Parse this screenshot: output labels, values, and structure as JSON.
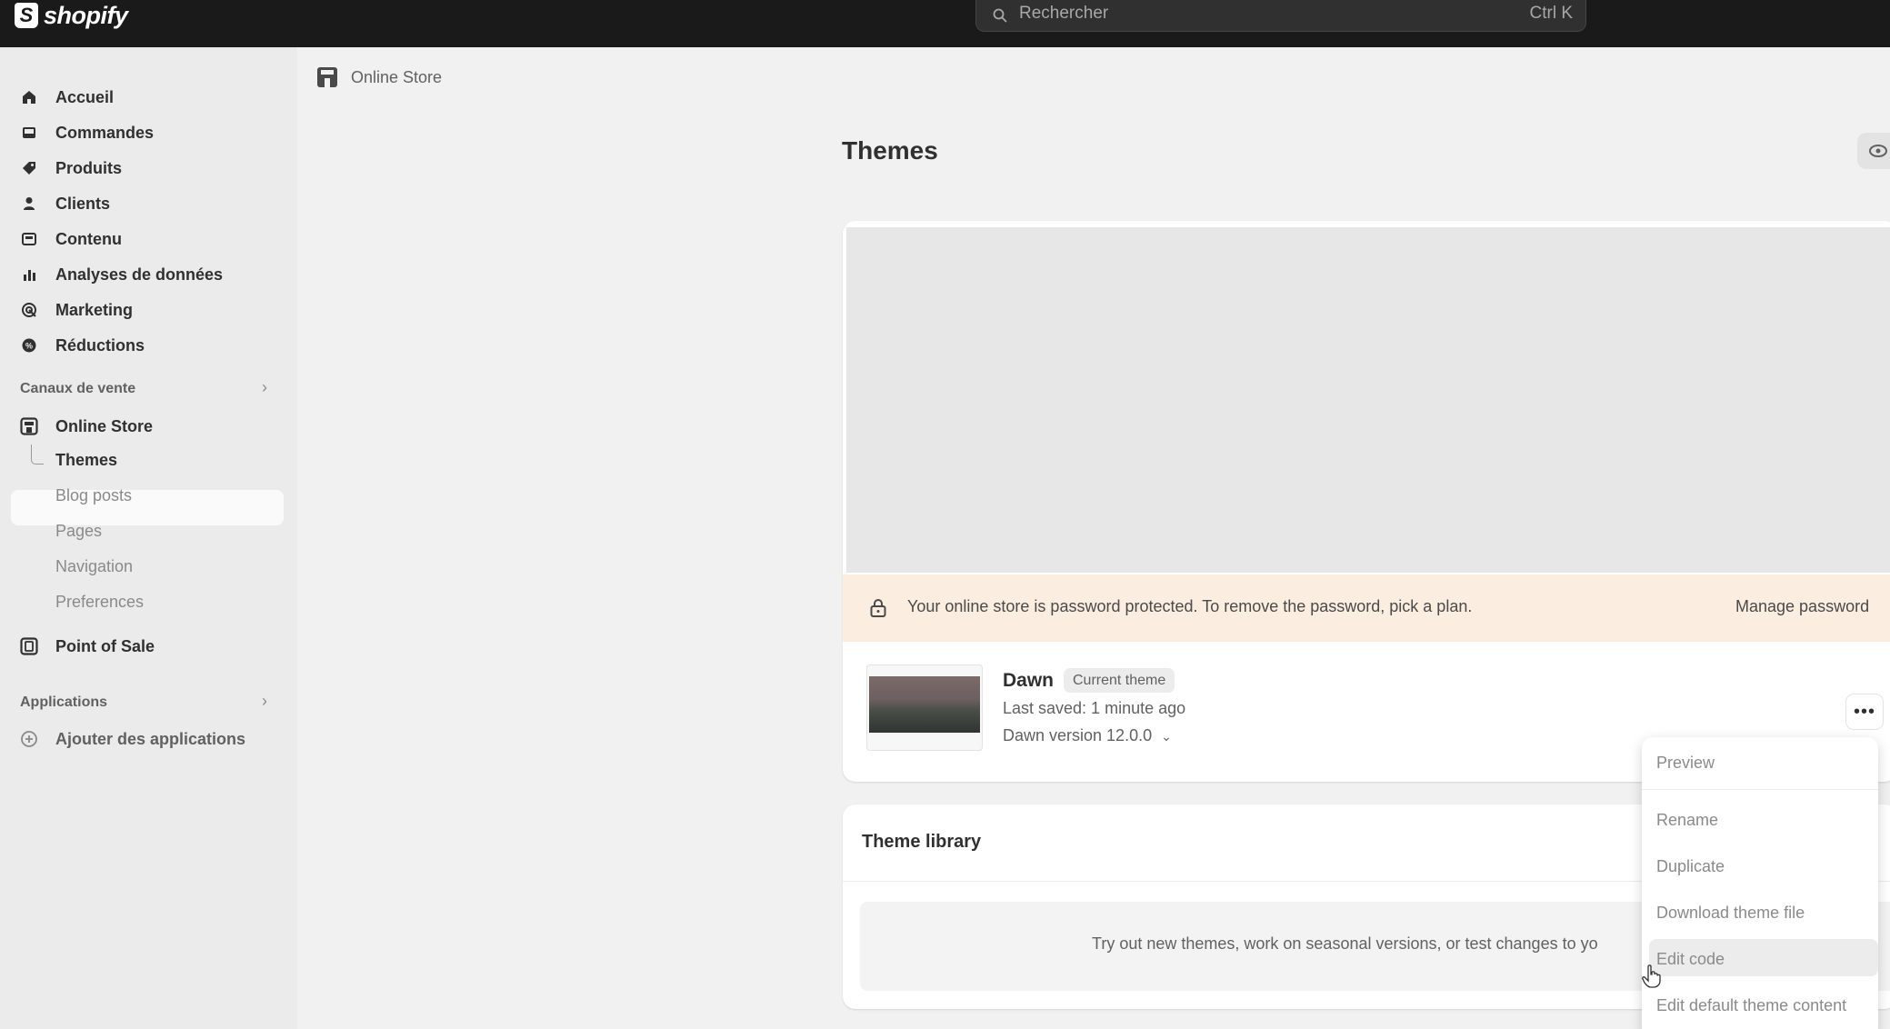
{
  "topbar": {
    "logo_text": "shopify",
    "search_placeholder": "Rechercher",
    "search_shortcut": "Ctrl K"
  },
  "sidebar": {
    "items": [
      {
        "label": "Accueil",
        "icon": "home-icon"
      },
      {
        "label": "Commandes",
        "icon": "inbox-icon"
      },
      {
        "label": "Produits",
        "icon": "tag-icon"
      },
      {
        "label": "Clients",
        "icon": "person-icon"
      },
      {
        "label": "Contenu",
        "icon": "content-icon"
      },
      {
        "label": "Analyses de données",
        "icon": "bar-chart-icon"
      },
      {
        "label": "Marketing",
        "icon": "target-icon"
      },
      {
        "label": "Réductions",
        "icon": "discount-icon"
      }
    ],
    "sales_channels_label": "Canaux de vente",
    "online_store_label": "Online Store",
    "subitems": [
      "Themes",
      "Blog posts",
      "Pages",
      "Navigation",
      "Preferences"
    ],
    "point_of_sale_label": "Point of Sale",
    "apps_label": "Applications",
    "add_apps_label": "Ajouter des applications"
  },
  "breadcrumb": {
    "label": "Online Store"
  },
  "page": {
    "title": "Themes"
  },
  "banner": {
    "text": "Your online store is password protected. To remove the password, pick a plan.",
    "link": "Manage password"
  },
  "current_theme": {
    "name": "Dawn",
    "badge": "Current theme",
    "last_saved": "Last saved: 1 minute ago",
    "version": "Dawn version 12.0.0",
    "more_label": "•••"
  },
  "theme_library": {
    "title": "Theme library",
    "empty_text": "Try out new themes, work on seasonal versions, or test changes to yo"
  },
  "dropdown": {
    "items": [
      "Preview",
      "Rename",
      "Duplicate",
      "Download theme file",
      "Edit code",
      "Edit default theme content"
    ]
  }
}
